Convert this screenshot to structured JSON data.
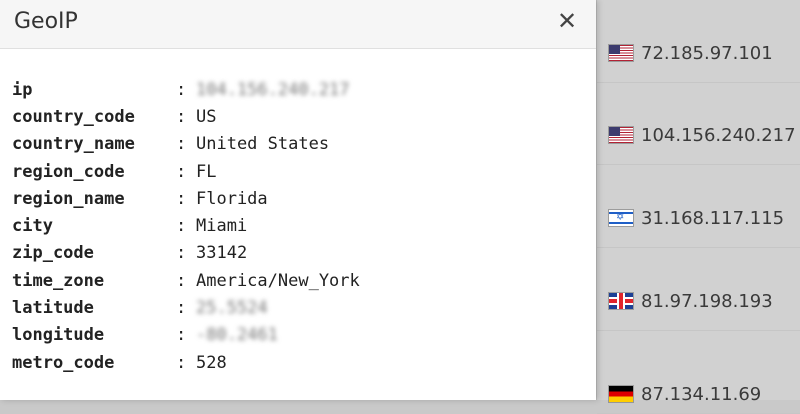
{
  "modal": {
    "title": "GeoIP",
    "close_label": "✕",
    "rows": [
      {
        "key": "ip",
        "sep": ":",
        "value": "104.156.240.217",
        "blurred": true
      },
      {
        "key": "country_code",
        "sep": ":",
        "value": "US",
        "blurred": false
      },
      {
        "key": "country_name",
        "sep": ":",
        "value": "United States",
        "blurred": false
      },
      {
        "key": "region_code",
        "sep": ":",
        "value": "FL",
        "blurred": false
      },
      {
        "key": "region_name",
        "sep": ":",
        "value": "Florida",
        "blurred": false
      },
      {
        "key": "city",
        "sep": ":",
        "value": "Miami",
        "blurred": false
      },
      {
        "key": "zip_code",
        "sep": ":",
        "value": "33142",
        "blurred": false
      },
      {
        "key": "time_zone",
        "sep": ":",
        "value": "America/New_York",
        "blurred": false
      },
      {
        "key": "latitude",
        "sep": ":",
        "value": "25.5524",
        "blurred": true
      },
      {
        "key": "longitude",
        "sep": ":",
        "value": "-80.2461",
        "blurred": true
      },
      {
        "key": "metro_code",
        "sep": ":",
        "value": "528",
        "blurred": false
      }
    ]
  },
  "ip_list": [
    {
      "flag": "us-flag-icon",
      "ip": "72.185.97.101"
    },
    {
      "flag": "us-flag-icon",
      "ip": "104.156.240.217"
    },
    {
      "flag": "il-flag-icon",
      "ip": "31.168.117.115"
    },
    {
      "flag": "gb-flag-icon",
      "ip": "81.97.198.193"
    },
    {
      "flag": "de-flag-icon",
      "ip": "87.134.11.69"
    }
  ]
}
